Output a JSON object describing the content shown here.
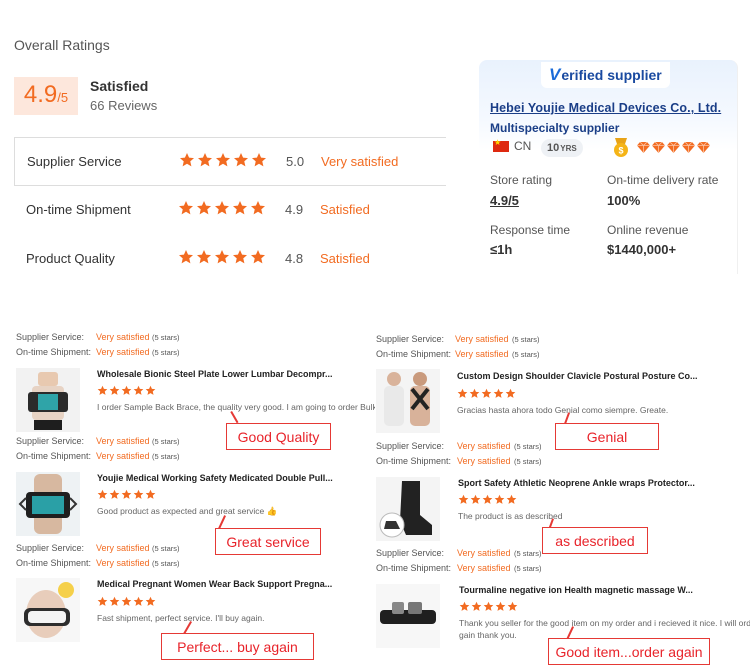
{
  "overall": {
    "title": "Overall Ratings",
    "score": "4.9",
    "out_of": "/5",
    "label": "Satisfied",
    "reviews": "66 Reviews"
  },
  "ratings": [
    {
      "label": "Supplier Service",
      "score": "5.0",
      "text": "Very satisfied",
      "stars": 5
    },
    {
      "label": "On-time Shipment",
      "score": "4.9",
      "text": "Satisfied",
      "stars": 5
    },
    {
      "label": "Product Quality",
      "score": "4.8",
      "text": "Satisfied",
      "stars": 5
    }
  ],
  "supplier": {
    "badge_v": "V",
    "badge_rest": "erified supplier",
    "name": "Hebei Youjie Medical Devices Co., Ltd.",
    "type": "Multispecialty supplier",
    "country": "CN",
    "years": "10",
    "years_unit": "YRS",
    "store_rating_label": "Store rating",
    "store_rating_value": "4.9/5",
    "delivery_label": "On-time delivery rate",
    "delivery_value": "100%",
    "response_label": "Response time",
    "response_value": "≤1h",
    "revenue_label": "Online revenue",
    "revenue_value": "$1440,000+"
  },
  "review_labels": {
    "service": "Supplier Service:",
    "shipment": "On-time Shipment:",
    "stars5": "(5 stars)"
  },
  "reviews": [
    {
      "service": "Very satisfied",
      "shipment": "Very satisfied",
      "product": "Wholesale Bionic Steel Plate Lower Lumbar Decompr...",
      "text": "I order Sample Back Brace, the quality very good. I am going to order Bulk",
      "callout": "Good Quality"
    },
    {
      "service": "Very satisfied",
      "shipment": "Very satisfied",
      "product": "Youjie Medical Working Safety Medicated Double Pull...",
      "text": "Good product as expected and great service 👍",
      "callout": "Great service"
    },
    {
      "service": "Very satisfied",
      "shipment": "Very satisfied",
      "product": "Medical Pregnant Women Wear Back Support Pregna...",
      "text": "Fast shipment, perfect service. I'll buy again.",
      "callout": "Perfect... buy again"
    },
    {
      "service": "Very satisfied",
      "shipment": "Very satisfied",
      "product": "Custom Design Shoulder Clavicle Postural Posture Co...",
      "text": "Gracias hasta ahora todo Genial como siempre. Greate.",
      "callout": "Genial"
    },
    {
      "service": "Very satisfied",
      "shipment": "Very satisfied",
      "product": "Sport Safety Athletic Neoprene Ankle wraps Protector...",
      "text": "The product is as described",
      "callout": "as described"
    },
    {
      "service": "Very satisfied",
      "shipment": "Very satisfied",
      "product": "Tourmaline negative ion Health magnetic massage W...",
      "text": "Thank you seller for the good item on my order and i recieved it nice. I will order again",
      "text2": "gain thank you.",
      "callout": "Good item...order again"
    }
  ],
  "colors": {
    "accent": "#f26b21",
    "callout": "#e53935",
    "supplier_blue": "#1a3e87"
  }
}
